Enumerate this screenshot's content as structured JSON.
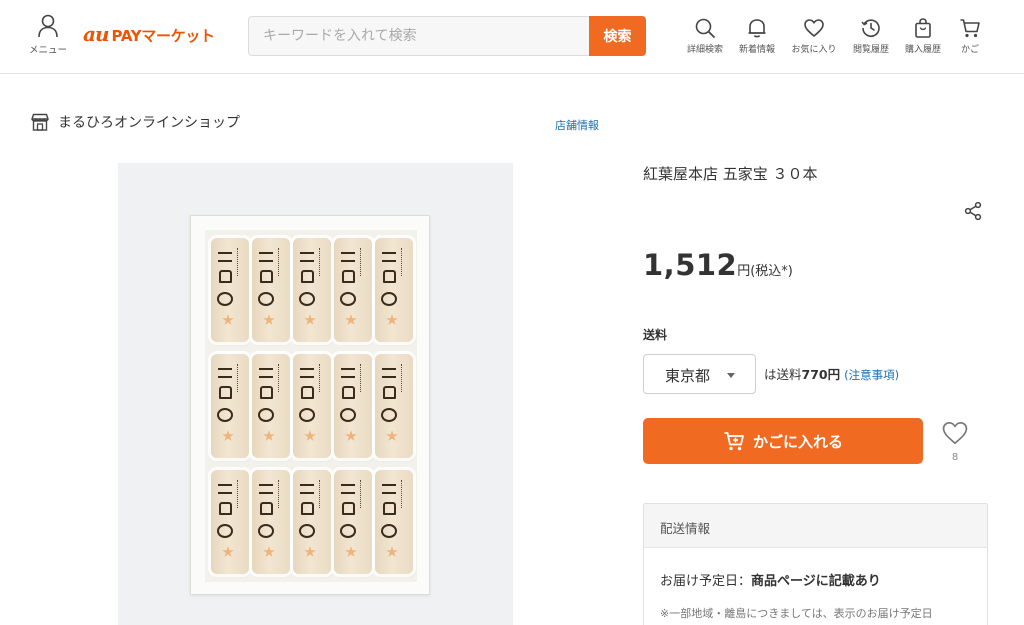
{
  "header": {
    "menu_label": "メニュー",
    "logo_au": "au",
    "logo_rest": "PAYマーケット",
    "search_placeholder": "キーワードを入れて検索",
    "search_button": "検索",
    "nav": [
      {
        "label": "詳細検索",
        "icon": "search-icon"
      },
      {
        "label": "新着情報",
        "icon": "bell-icon"
      },
      {
        "label": "お気に入り",
        "icon": "heart-icon"
      },
      {
        "label": "閲覧履歴",
        "icon": "history-icon"
      },
      {
        "label": "購入履歴",
        "icon": "shopping-bag-icon"
      },
      {
        "label": "かご",
        "icon": "cart-icon"
      }
    ]
  },
  "shop": {
    "name": "まるひろオンラインショップ",
    "info_link": "店舗情報"
  },
  "product": {
    "title": "紅葉屋本店 五家宝 ３０本",
    "price": "1,512",
    "price_unit": "円(税込*)",
    "shipping_label": "送料",
    "prefecture": "東京都",
    "shipping_prefix": "は送料",
    "shipping_fee": "770円",
    "shipping_note": "(注意事項)",
    "cart_button": "かごに入れる",
    "favorite_count": "8"
  },
  "delivery": {
    "heading": "配送情報",
    "date_label": "お届け予定日：",
    "date_value": "商品ページに記載あり",
    "note": "※一部地域・離島につきましては、表示のお届け予定日"
  },
  "colors": {
    "accent": "#f06a21",
    "logo": "#eb5505",
    "link": "#1a6fb5"
  }
}
